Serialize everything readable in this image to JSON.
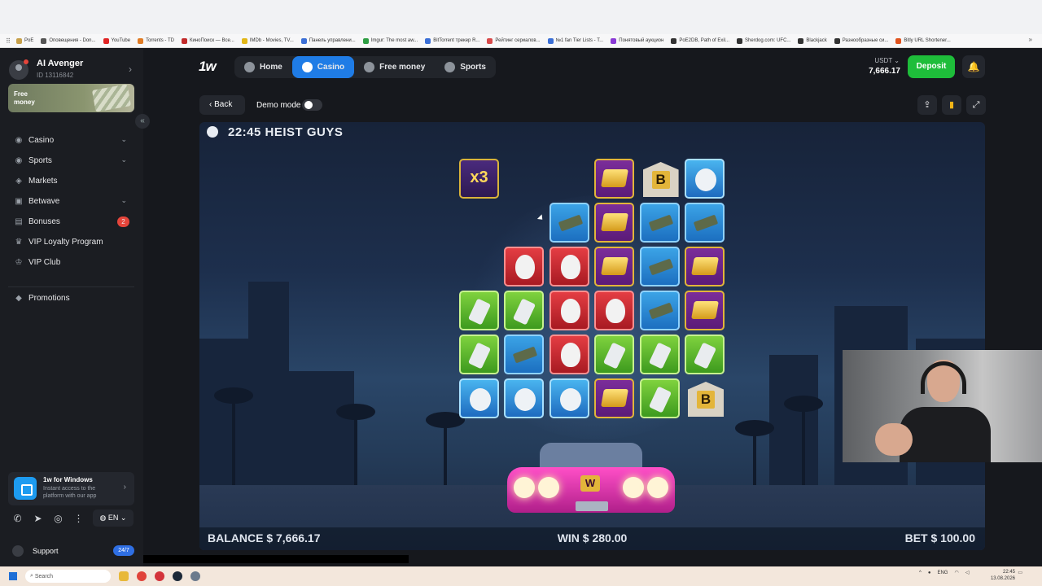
{
  "browser": {
    "bookmarks": [
      "PoE",
      "Оповещения - Don...",
      "YouTube",
      "Torrents - TD",
      "КиноПоиск — Все...",
      "IMDb - Movies, TV...",
      "Панель управлени...",
      "Imgur: The most aw...",
      "BitTorrent трекер R...",
      "Рейтинг сериалов...",
      "№1 fan Tier Lists - T...",
      "Понятовый аукцион",
      "PoE2DB, Path of Exil...",
      "Sherdog.com: UFC...",
      "Blackjack",
      "Разнообразные си...",
      "Bitly URL Shortener..."
    ],
    "bookmark_colors": [
      "#c7a04a",
      "#555555",
      "#e02424",
      "#e07b24",
      "#c12a2a",
      "#e2b616",
      "#3b6fd6",
      "#2f9e44",
      "#3b6fd6",
      "#d84a4a",
      "#3b6fd6",
      "#8a3ad6",
      "#333333",
      "#333333",
      "#333333",
      "#333333",
      "#e0531e"
    ]
  },
  "sidebar": {
    "username": "AI Avenger",
    "user_id": "ID 13116842",
    "promo_label": "Free money",
    "items": [
      {
        "label": "Casino",
        "icon": "casino-icon",
        "chevron": true
      },
      {
        "label": "Sports",
        "icon": "sports-icon",
        "chevron": true
      },
      {
        "label": "Markets",
        "icon": "markets-icon",
        "chevron": false
      },
      {
        "label": "Betwave",
        "icon": "betwave-icon",
        "chevron": true
      },
      {
        "label": "Bonuses",
        "icon": "gift-icon",
        "badge": "2"
      },
      {
        "label": "VIP Loyalty Program",
        "icon": "trophy-icon"
      },
      {
        "label": "VIP Club",
        "icon": "crown-icon"
      },
      {
        "label": "Promotions",
        "icon": "promo-icon"
      }
    ],
    "app_card": {
      "title": "1w for Windows",
      "subtitle": "Instant access to the platform with our app"
    },
    "language": "EN",
    "support_label": "Support",
    "support_badge": "24/7"
  },
  "header": {
    "logo": "1w",
    "tabs": [
      "Home",
      "Casino",
      "Free money",
      "Sports"
    ],
    "active_tab": "Casino",
    "currency": "USDT",
    "balance": "7,666.17",
    "deposit_label": "Deposit"
  },
  "toolbar": {
    "back_label": "Back",
    "demo_label": "Demo mode"
  },
  "game": {
    "title": "22:45 HEIST GUYS",
    "multiplier": "x3",
    "balance": "BALANCE $ 7,666.17",
    "win": "WIN $ 280.00",
    "bet": "BET $ 100.00",
    "car_badge": "W",
    "grid_symbols": [
      [
        "mult",
        "",
        "",
        "gold",
        "bank",
        "bird"
      ],
      [
        "",
        "",
        "gun",
        "gold",
        "gun",
        "gun"
      ],
      [
        "",
        "mask",
        "mask",
        "gold",
        "gun",
        "gold"
      ],
      [
        "bomb",
        "bomb",
        "mask",
        "mask",
        "gun",
        "gold"
      ],
      [
        "bomb",
        "gun",
        "mask",
        "bomb",
        "bomb",
        "bomb"
      ],
      [
        "bird",
        "bird",
        "bird",
        "gold",
        "bomb",
        "bank"
      ]
    ],
    "bank_letter": "B"
  },
  "taskbar": {
    "search_placeholder": "Search",
    "lang": "ENG",
    "time": "22:45",
    "date": "13.08.2026"
  }
}
